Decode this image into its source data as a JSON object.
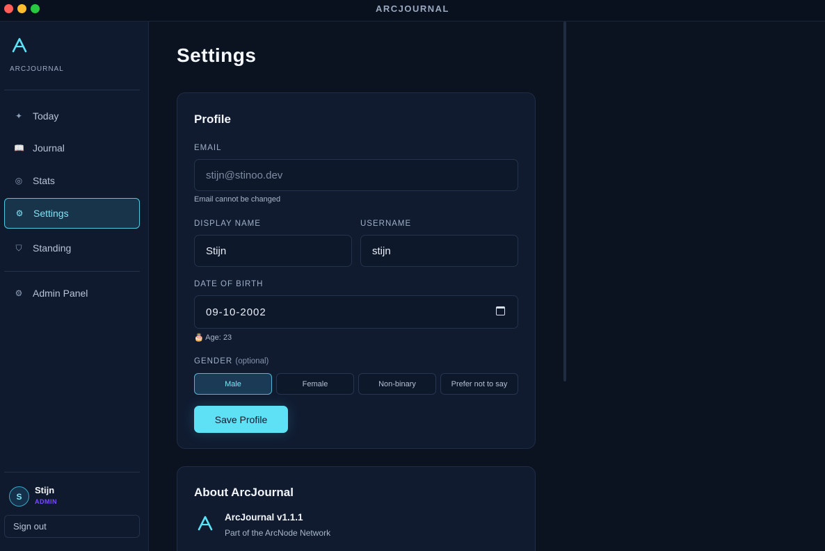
{
  "window": {
    "title": "ARCJOURNAL"
  },
  "sidebar": {
    "brand": "ARCJOURNAL",
    "items": [
      {
        "label": "Today",
        "icon": "sparkle-icon",
        "glyph": "✦"
      },
      {
        "label": "Journal",
        "icon": "book-icon",
        "glyph": "📖"
      },
      {
        "label": "Stats",
        "icon": "stats-icon",
        "glyph": "◎"
      },
      {
        "label": "Settings",
        "icon": "gear-icon",
        "glyph": "⚙",
        "active": true
      },
      {
        "label": "Standing",
        "icon": "shield-icon",
        "glyph": "⛉"
      }
    ],
    "admin": {
      "label": "Admin Panel",
      "icon": "gear-icon",
      "glyph": "⚙"
    },
    "user": {
      "initial": "S",
      "name": "Stijn",
      "role": "ADMIN"
    },
    "signout_label": "Sign out"
  },
  "page": {
    "title": "Settings"
  },
  "profile": {
    "title": "Profile",
    "email_label": "EMAIL",
    "email_value": "stijn@stinoo.dev",
    "email_hint": "Email cannot be changed",
    "display_name_label": "DISPLAY NAME",
    "display_name_value": "Stijn",
    "username_label": "USERNAME",
    "username_value": "stijn",
    "dob_label": "DATE OF BIRTH",
    "dob_value": "09-10-2002",
    "age_hint": "🎂 Age: 23",
    "gender_label": "GENDER",
    "gender_optional": "(optional)",
    "gender_options": [
      "Male",
      "Female",
      "Non-binary",
      "Prefer not to say"
    ],
    "gender_selected": "Male",
    "save_label": "Save Profile"
  },
  "about": {
    "title": "About ArcJournal",
    "app_name": "ArcJournal v1.1.1",
    "subtitle": "Part of the ArcNode Network"
  },
  "colors": {
    "accent": "#5ee0f5",
    "admin_role": "#7b4bff",
    "background": "#0b1220",
    "sidebar": "#0f1a2e",
    "card": "#101b30"
  }
}
